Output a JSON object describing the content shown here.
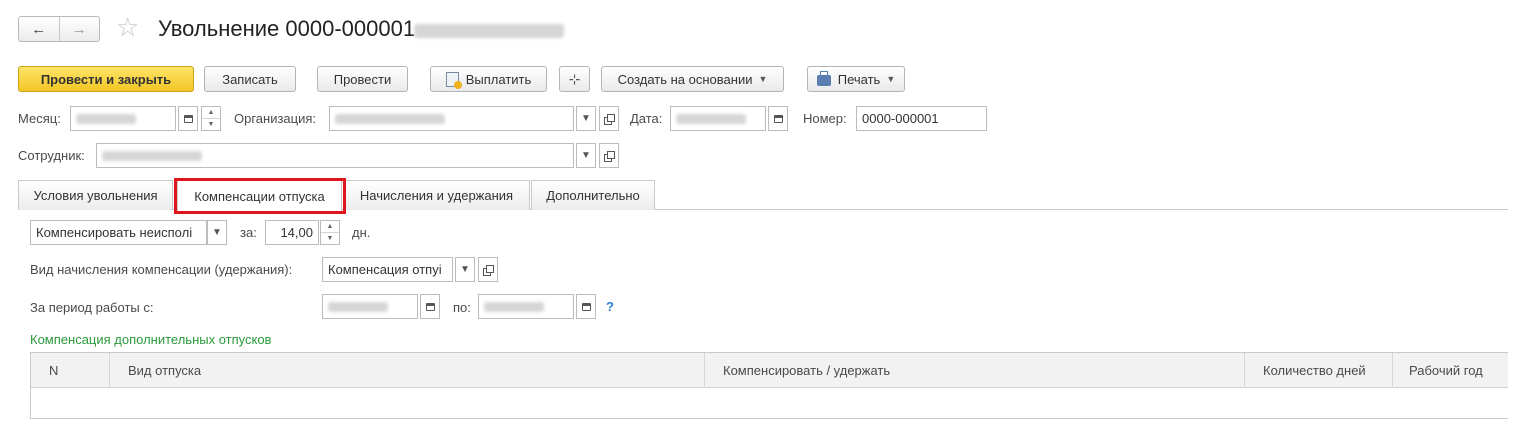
{
  "title": "Увольнение 0000-000001",
  "nav": {
    "back": "←",
    "forward": "→"
  },
  "toolbar": {
    "post_close": "Провести и закрыть",
    "save": "Записать",
    "post": "Провести",
    "pay": "Выплатить",
    "create_based": "Создать на основании",
    "print": "Печать"
  },
  "header": {
    "month_label": "Месяц:",
    "org_label": "Организация:",
    "date_label": "Дата:",
    "number_label": "Номер:",
    "number_value": "0000-000001",
    "employee_label": "Сотрудник:"
  },
  "tabs": [
    {
      "label": "Условия увольнения"
    },
    {
      "label": "Компенсации отпуска"
    },
    {
      "label": "Начисления и удержания"
    },
    {
      "label": "Дополнительно"
    }
  ],
  "comp": {
    "mode_value": "Компенсировать неисполі",
    "for_label": "за:",
    "days_value": "14,00",
    "days_unit": "дн.",
    "type_label": "Вид начисления компенсации (удержания):",
    "type_value": "Компенсация отпуі",
    "period_label": "За период работы с:",
    "to_label": "по:",
    "help": "?",
    "additional_section": "Компенсация дополнительных отпусков"
  },
  "table": {
    "columns": [
      "N",
      "Вид отпуска",
      "Компенсировать / удержать",
      "Количество дней",
      "Рабочий год"
    ]
  }
}
